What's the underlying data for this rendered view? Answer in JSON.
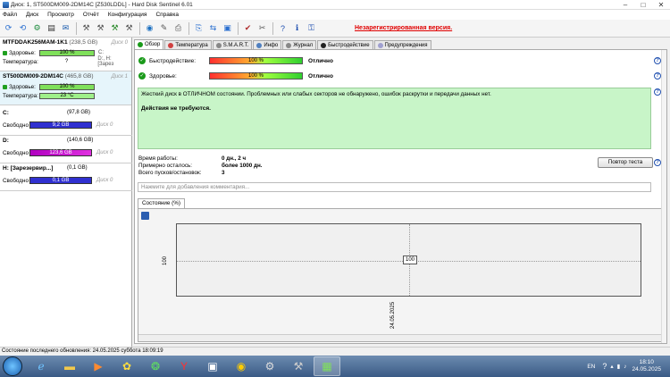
{
  "window": {
    "title": "Диск: 1, ST500DM009-2DM14C [Z530LDDL] - Hard Disk Sentinel 6.01"
  },
  "menu": [
    "Файл",
    "Диск",
    "Просмотр",
    "Отчёт",
    "Конфигурация",
    "Справка"
  ],
  "toolbar": {
    "unregistered": "Незарегистрированная версия."
  },
  "disks": [
    {
      "name": "MTFDDAK256MAM-1K1",
      "size": "(238,5 GB)",
      "num": "Диск 0",
      "health_label": "Здоровье:",
      "health": "100 %",
      "health_side": "C:",
      "temp_label": "Температура:",
      "temp": "?",
      "temp_side": "D:, H: [Зарез"
    },
    {
      "name": "ST500DM009-2DM14C",
      "size": "(465,8 GB)",
      "num": "Диск 1",
      "health_label": "Здоровье:",
      "health": "100 %",
      "health_side": "",
      "temp_label": "Температура:",
      "temp": "23 °C",
      "temp_side": ""
    }
  ],
  "volumes": [
    {
      "name": "C:",
      "size": "(97,8 GB)",
      "free_label": "Свободно",
      "free": "9,2 GB",
      "num": "Диск 0",
      "color": "blue"
    },
    {
      "name": "D:",
      "size": "(140,6 GB)",
      "free_label": "Свободно",
      "free": "123,6 GB",
      "num": "Диск 0",
      "color": "pink"
    },
    {
      "name": "H: [Зарезервир...]",
      "size": "(0,1 GB)",
      "free_label": "Свободно",
      "free": "0,1 GB",
      "num": "Диск 0",
      "color": "blue"
    }
  ],
  "tabs": [
    "Обзор",
    "Температура",
    "S.M.A.R.T.",
    "Инфо",
    "Журнал",
    "Быстродействие",
    "Предупреждения"
  ],
  "overview": {
    "perf_label": "Быстродействие:",
    "perf_value": "100 %",
    "perf_status": "Отлично",
    "health_label": "Здоровье:",
    "health_value": "100 %",
    "health_status": "Отлично",
    "message": "Жесткий диск в ОТЛИЧНОМ состоянии. Проблемных или слабых секторов не обнаружено, ошибок раскрутки и передачи данных нет.",
    "action": "Действия не требуются.",
    "uptime_label": "Время работы:",
    "uptime": "0 дн., 2 ч",
    "remaining_label": "Примерно осталось:",
    "remaining": "более 1000 дн.",
    "starts_label": "Всего пусков/остановок:",
    "starts": "3",
    "retest_button": "Повтор теста",
    "comment_placeholder": "Нажмите для добавления комментария..."
  },
  "graph": {
    "tab": "Состояние (%)"
  },
  "chart_data": {
    "type": "line",
    "x": [
      "24.05.2025"
    ],
    "series": [
      {
        "values": [
          100
        ]
      }
    ],
    "ylabel": "100",
    "point_label": "100"
  },
  "statusbar": "Состояние последнего обновления: 24.05.2025 суббота 18:09:19",
  "tray": {
    "lang": "EN",
    "time": "18:10",
    "date": "24.05.2025"
  }
}
